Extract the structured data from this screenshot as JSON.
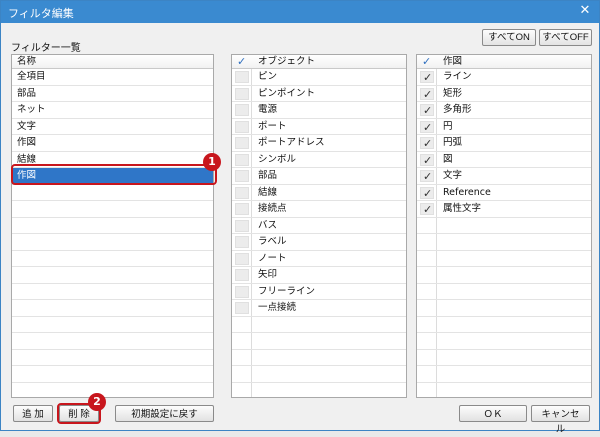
{
  "window": {
    "title": "フィルタ編集",
    "close_glyph": "✕"
  },
  "filter_list": {
    "section_label": "フィルター一覧",
    "header": "名称",
    "items": [
      "全項目",
      "部品",
      "ネット",
      "文字",
      "作図",
      "結線",
      "作図"
    ],
    "selected_index": 6
  },
  "top_buttons": {
    "all_on": "すべてON",
    "all_off": "すべてOFF"
  },
  "object_panel": {
    "header": "オブジェクト",
    "items": [
      {
        "label": "ピン",
        "checked": false
      },
      {
        "label": "ピンポイント",
        "checked": false
      },
      {
        "label": "電源",
        "checked": false
      },
      {
        "label": "ポート",
        "checked": false
      },
      {
        "label": "ポートアドレス",
        "checked": false
      },
      {
        "label": "シンボル",
        "checked": false
      },
      {
        "label": "部品",
        "checked": false
      },
      {
        "label": "結線",
        "checked": false
      },
      {
        "label": "接続点",
        "checked": false
      },
      {
        "label": "バス",
        "checked": false
      },
      {
        "label": "ラベル",
        "checked": false
      },
      {
        "label": "ノート",
        "checked": false
      },
      {
        "label": "矢印",
        "checked": false
      },
      {
        "label": "フリーライン",
        "checked": false
      },
      {
        "label": "一点接続",
        "checked": false
      }
    ]
  },
  "drawing_panel": {
    "header": "作図",
    "items": [
      {
        "label": "ライン",
        "checked": true
      },
      {
        "label": "矩形",
        "checked": true
      },
      {
        "label": "多角形",
        "checked": true
      },
      {
        "label": "円",
        "checked": true
      },
      {
        "label": "円弧",
        "checked": true
      },
      {
        "label": "図",
        "checked": true
      },
      {
        "label": "文字",
        "checked": true
      },
      {
        "label": "Reference",
        "checked": true
      },
      {
        "label": "属性文字",
        "checked": true
      }
    ]
  },
  "bottom_buttons": {
    "add": "追 加",
    "delete": "削 除",
    "reset": "初期設定に戻す",
    "ok": "ＯＫ",
    "cancel": "キャンセル"
  },
  "callouts": [
    "1",
    "2"
  ],
  "colors": {
    "accent": "#3a8ad0",
    "selection": "#2f76c8",
    "callout": "#c8161d",
    "check": "#2f6fbf"
  }
}
